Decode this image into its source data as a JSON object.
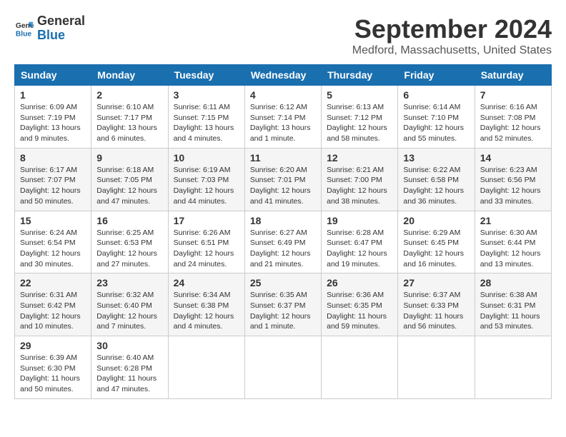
{
  "logo": {
    "text_general": "General",
    "text_blue": "Blue"
  },
  "title": "September 2024",
  "subtitle": "Medford, Massachusetts, United States",
  "weekdays": [
    "Sunday",
    "Monday",
    "Tuesday",
    "Wednesday",
    "Thursday",
    "Friday",
    "Saturday"
  ],
  "weeks": [
    [
      {
        "day": "1",
        "sunrise": "Sunrise: 6:09 AM",
        "sunset": "Sunset: 7:19 PM",
        "daylight": "Daylight: 13 hours and 9 minutes."
      },
      {
        "day": "2",
        "sunrise": "Sunrise: 6:10 AM",
        "sunset": "Sunset: 7:17 PM",
        "daylight": "Daylight: 13 hours and 6 minutes."
      },
      {
        "day": "3",
        "sunrise": "Sunrise: 6:11 AM",
        "sunset": "Sunset: 7:15 PM",
        "daylight": "Daylight: 13 hours and 4 minutes."
      },
      {
        "day": "4",
        "sunrise": "Sunrise: 6:12 AM",
        "sunset": "Sunset: 7:14 PM",
        "daylight": "Daylight: 13 hours and 1 minute."
      },
      {
        "day": "5",
        "sunrise": "Sunrise: 6:13 AM",
        "sunset": "Sunset: 7:12 PM",
        "daylight": "Daylight: 12 hours and 58 minutes."
      },
      {
        "day": "6",
        "sunrise": "Sunrise: 6:14 AM",
        "sunset": "Sunset: 7:10 PM",
        "daylight": "Daylight: 12 hours and 55 minutes."
      },
      {
        "day": "7",
        "sunrise": "Sunrise: 6:16 AM",
        "sunset": "Sunset: 7:08 PM",
        "daylight": "Daylight: 12 hours and 52 minutes."
      }
    ],
    [
      {
        "day": "8",
        "sunrise": "Sunrise: 6:17 AM",
        "sunset": "Sunset: 7:07 PM",
        "daylight": "Daylight: 12 hours and 50 minutes."
      },
      {
        "day": "9",
        "sunrise": "Sunrise: 6:18 AM",
        "sunset": "Sunset: 7:05 PM",
        "daylight": "Daylight: 12 hours and 47 minutes."
      },
      {
        "day": "10",
        "sunrise": "Sunrise: 6:19 AM",
        "sunset": "Sunset: 7:03 PM",
        "daylight": "Daylight: 12 hours and 44 minutes."
      },
      {
        "day": "11",
        "sunrise": "Sunrise: 6:20 AM",
        "sunset": "Sunset: 7:01 PM",
        "daylight": "Daylight: 12 hours and 41 minutes."
      },
      {
        "day": "12",
        "sunrise": "Sunrise: 6:21 AM",
        "sunset": "Sunset: 7:00 PM",
        "daylight": "Daylight: 12 hours and 38 minutes."
      },
      {
        "day": "13",
        "sunrise": "Sunrise: 6:22 AM",
        "sunset": "Sunset: 6:58 PM",
        "daylight": "Daylight: 12 hours and 36 minutes."
      },
      {
        "day": "14",
        "sunrise": "Sunrise: 6:23 AM",
        "sunset": "Sunset: 6:56 PM",
        "daylight": "Daylight: 12 hours and 33 minutes."
      }
    ],
    [
      {
        "day": "15",
        "sunrise": "Sunrise: 6:24 AM",
        "sunset": "Sunset: 6:54 PM",
        "daylight": "Daylight: 12 hours and 30 minutes."
      },
      {
        "day": "16",
        "sunrise": "Sunrise: 6:25 AM",
        "sunset": "Sunset: 6:53 PM",
        "daylight": "Daylight: 12 hours and 27 minutes."
      },
      {
        "day": "17",
        "sunrise": "Sunrise: 6:26 AM",
        "sunset": "Sunset: 6:51 PM",
        "daylight": "Daylight: 12 hours and 24 minutes."
      },
      {
        "day": "18",
        "sunrise": "Sunrise: 6:27 AM",
        "sunset": "Sunset: 6:49 PM",
        "daylight": "Daylight: 12 hours and 21 minutes."
      },
      {
        "day": "19",
        "sunrise": "Sunrise: 6:28 AM",
        "sunset": "Sunset: 6:47 PM",
        "daylight": "Daylight: 12 hours and 19 minutes."
      },
      {
        "day": "20",
        "sunrise": "Sunrise: 6:29 AM",
        "sunset": "Sunset: 6:45 PM",
        "daylight": "Daylight: 12 hours and 16 minutes."
      },
      {
        "day": "21",
        "sunrise": "Sunrise: 6:30 AM",
        "sunset": "Sunset: 6:44 PM",
        "daylight": "Daylight: 12 hours and 13 minutes."
      }
    ],
    [
      {
        "day": "22",
        "sunrise": "Sunrise: 6:31 AM",
        "sunset": "Sunset: 6:42 PM",
        "daylight": "Daylight: 12 hours and 10 minutes."
      },
      {
        "day": "23",
        "sunrise": "Sunrise: 6:32 AM",
        "sunset": "Sunset: 6:40 PM",
        "daylight": "Daylight: 12 hours and 7 minutes."
      },
      {
        "day": "24",
        "sunrise": "Sunrise: 6:34 AM",
        "sunset": "Sunset: 6:38 PM",
        "daylight": "Daylight: 12 hours and 4 minutes."
      },
      {
        "day": "25",
        "sunrise": "Sunrise: 6:35 AM",
        "sunset": "Sunset: 6:37 PM",
        "daylight": "Daylight: 12 hours and 1 minute."
      },
      {
        "day": "26",
        "sunrise": "Sunrise: 6:36 AM",
        "sunset": "Sunset: 6:35 PM",
        "daylight": "Daylight: 11 hours and 59 minutes."
      },
      {
        "day": "27",
        "sunrise": "Sunrise: 6:37 AM",
        "sunset": "Sunset: 6:33 PM",
        "daylight": "Daylight: 11 hours and 56 minutes."
      },
      {
        "day": "28",
        "sunrise": "Sunrise: 6:38 AM",
        "sunset": "Sunset: 6:31 PM",
        "daylight": "Daylight: 11 hours and 53 minutes."
      }
    ],
    [
      {
        "day": "29",
        "sunrise": "Sunrise: 6:39 AM",
        "sunset": "Sunset: 6:30 PM",
        "daylight": "Daylight: 11 hours and 50 minutes."
      },
      {
        "day": "30",
        "sunrise": "Sunrise: 6:40 AM",
        "sunset": "Sunset: 6:28 PM",
        "daylight": "Daylight: 11 hours and 47 minutes."
      },
      null,
      null,
      null,
      null,
      null
    ]
  ]
}
